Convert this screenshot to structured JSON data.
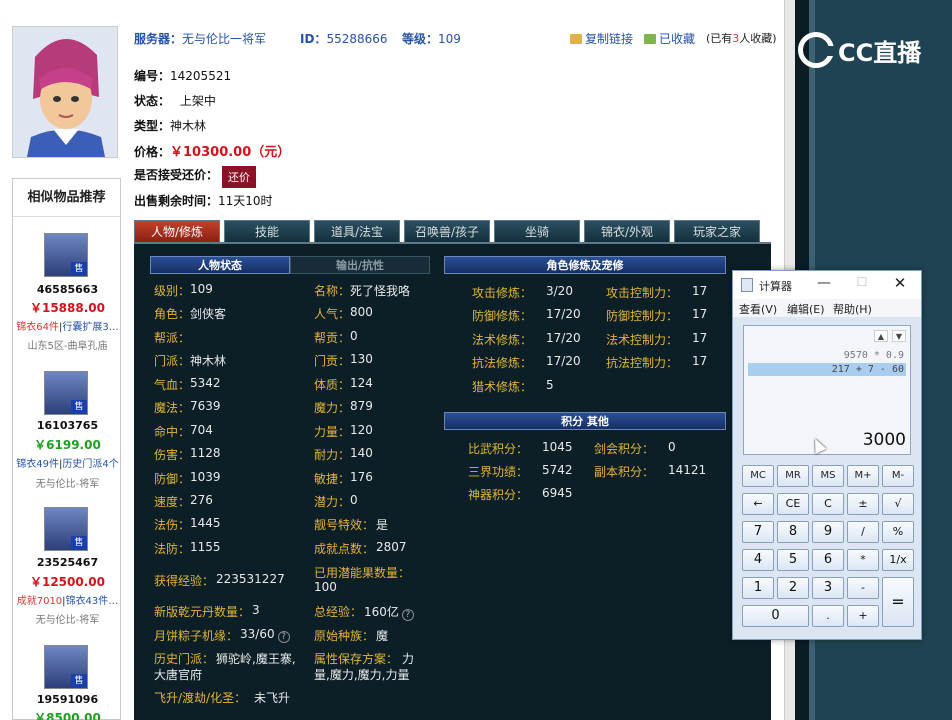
{
  "watermark": {
    "brand": "CC直播"
  },
  "header": {
    "server_label": "服务器：",
    "server_value": "无与伦比一将军",
    "id_label": "ID：",
    "id_value": "55288666",
    "level_label": "等级：",
    "level_value": "109",
    "copy_link": "复制链接",
    "favorited": "已收藏",
    "fav_count_prefix": "(已有",
    "fav_count": "3",
    "fav_count_suffix": "人收藏)"
  },
  "info": {
    "number_label": "编号：",
    "number_value": "14205521",
    "status_label": "状态：",
    "status_value": "上架中",
    "type_label": "类型：",
    "type_value": "神木林",
    "price_label": "价格：",
    "price_value": "￥10300.00（元）",
    "counter_label": "是否接受还价：",
    "counter_button": "还价",
    "remaining_label": "出售剩余时间：",
    "remaining_value": "11天10时"
  },
  "similar": {
    "title": "相似物品推荐",
    "items": [
      {
        "id": "46585663",
        "price": "￥15888.00",
        "price_color": "#d5121b",
        "tag1": "锦衣64件",
        "tag2": "行囊扩展3…",
        "server": "山东5区-曲阜孔庙"
      },
      {
        "id": "16103765",
        "price": "￥6199.00",
        "price_color": "#1f9e22",
        "tag1": "锦衣49件",
        "tag2": "历史门派4个",
        "server": "无与伦比-将军"
      },
      {
        "id": "23525467",
        "price": "￥12500.00",
        "price_color": "#d5121b",
        "tag1": "成就7010",
        "tag2": "锦衣43件…",
        "server": "无与伦比-将军"
      },
      {
        "id": "19591096",
        "price": "￥8500.00",
        "price_color": "#1f9e22"
      }
    ],
    "badge": "售"
  },
  "tabs": [
    "人物/修炼",
    "技能",
    "道具/法宝",
    "召唤兽/孩子",
    "坐骑",
    "锦衣/外观",
    "玩家之家"
  ],
  "panel": {
    "sec_status": "人物状态",
    "sec_output": "输出/抗性",
    "sec_cultivation": "角色修炼及宠修",
    "sec_points": "积分 其他",
    "col1": [
      {
        "k": "级别：",
        "v": "109"
      },
      {
        "k": "角色：",
        "v": "剑侠客"
      },
      {
        "k": "帮派：",
        "v": ""
      },
      {
        "k": "门派：",
        "v": "神木林"
      },
      {
        "k": "气血：",
        "v": "5342"
      },
      {
        "k": "魔法：",
        "v": "7639"
      },
      {
        "k": "命中：",
        "v": "704"
      },
      {
        "k": "伤害：",
        "v": "1128"
      },
      {
        "k": "防御：",
        "v": "1039"
      },
      {
        "k": "速度：",
        "v": "276"
      },
      {
        "k": "法伤：",
        "v": "1445"
      },
      {
        "k": "法防：",
        "v": "1155"
      }
    ],
    "col2": [
      {
        "k": "名称：",
        "v": "死了怪我咯"
      },
      {
        "k": "人气：",
        "v": "800"
      },
      {
        "k": "帮贡：",
        "v": "0"
      },
      {
        "k": "门贡：",
        "v": "130"
      },
      {
        "k": "体质：",
        "v": "124"
      },
      {
        "k": "魔力：",
        "v": "879"
      },
      {
        "k": "力量：",
        "v": "120"
      },
      {
        "k": "耐力：",
        "v": "140"
      },
      {
        "k": "敏捷：",
        "v": "176"
      },
      {
        "k": "潜力：",
        "v": "0"
      },
      {
        "k": "靓号特效：",
        "v": "是"
      },
      {
        "k": "成就点数：",
        "v": "2807"
      }
    ],
    "exp_label": "获得经验：",
    "exp_value": "223531227",
    "used_fruit_label": "已用潜能果数量：",
    "used_fruit_value": "100",
    "qiankun_label": "新版乾元丹数量：",
    "qiankun_value": "3",
    "total_exp_label": "总经验：",
    "total_exp_value": "160亿",
    "mooncake_label": "月饼粽子机缘：",
    "mooncake_value": "33/60",
    "race_label": "原始种族：",
    "race_value": "魔",
    "history_label": "历史门派：",
    "history_value1": "狮驼岭,魔王寨,",
    "history_value2": "大唐官府",
    "scheme_label": "属性保存方案：",
    "scheme_value1": "力",
    "scheme_value2": "量,魔力,魔力,力量",
    "ascend_label": "飞升/渡劫/化圣：",
    "ascend_value": "未飞升",
    "cult": [
      {
        "k": "攻击修炼：",
        "v": "3/20",
        "k2": "攻击控制力：",
        "v2": "17"
      },
      {
        "k": "防御修炼：",
        "v": "17/20",
        "k2": "防御控制力：",
        "v2": "17"
      },
      {
        "k": "法术修炼：",
        "v": "17/20",
        "k2": "法术控制力：",
        "v2": "17"
      },
      {
        "k": "抗法修炼：",
        "v": "17/20",
        "k2": "抗法控制力：",
        "v2": "17"
      },
      {
        "k": "猎术修炼：",
        "v": "5"
      }
    ],
    "points": [
      {
        "k": "比武积分：",
        "v": "1045",
        "k2": "剑会积分：",
        "v2": "0"
      },
      {
        "k": "三界功绩：",
        "v": "5742",
        "k2": "副本积分：",
        "v2": "14121"
      },
      {
        "k": "神器积分：",
        "v": "6945"
      }
    ]
  },
  "calculator": {
    "title": "计算器",
    "menu": [
      "查看(V)",
      "编辑(E)",
      "帮助(H)"
    ],
    "history1": "9570 * 0.9",
    "history2": "217 + 7 - 60",
    "result": "3000",
    "keys": [
      [
        "MC",
        "MR",
        "MS",
        "M+",
        "M-"
      ],
      [
        "←",
        "CE",
        "C",
        "±",
        "√"
      ],
      [
        "7",
        "8",
        "9",
        "/",
        "%"
      ],
      [
        "4",
        "5",
        "6",
        "*",
        "1/x"
      ],
      [
        "1",
        "2",
        "3",
        "-",
        "="
      ],
      [
        "0",
        ".",
        "+"
      ]
    ]
  }
}
